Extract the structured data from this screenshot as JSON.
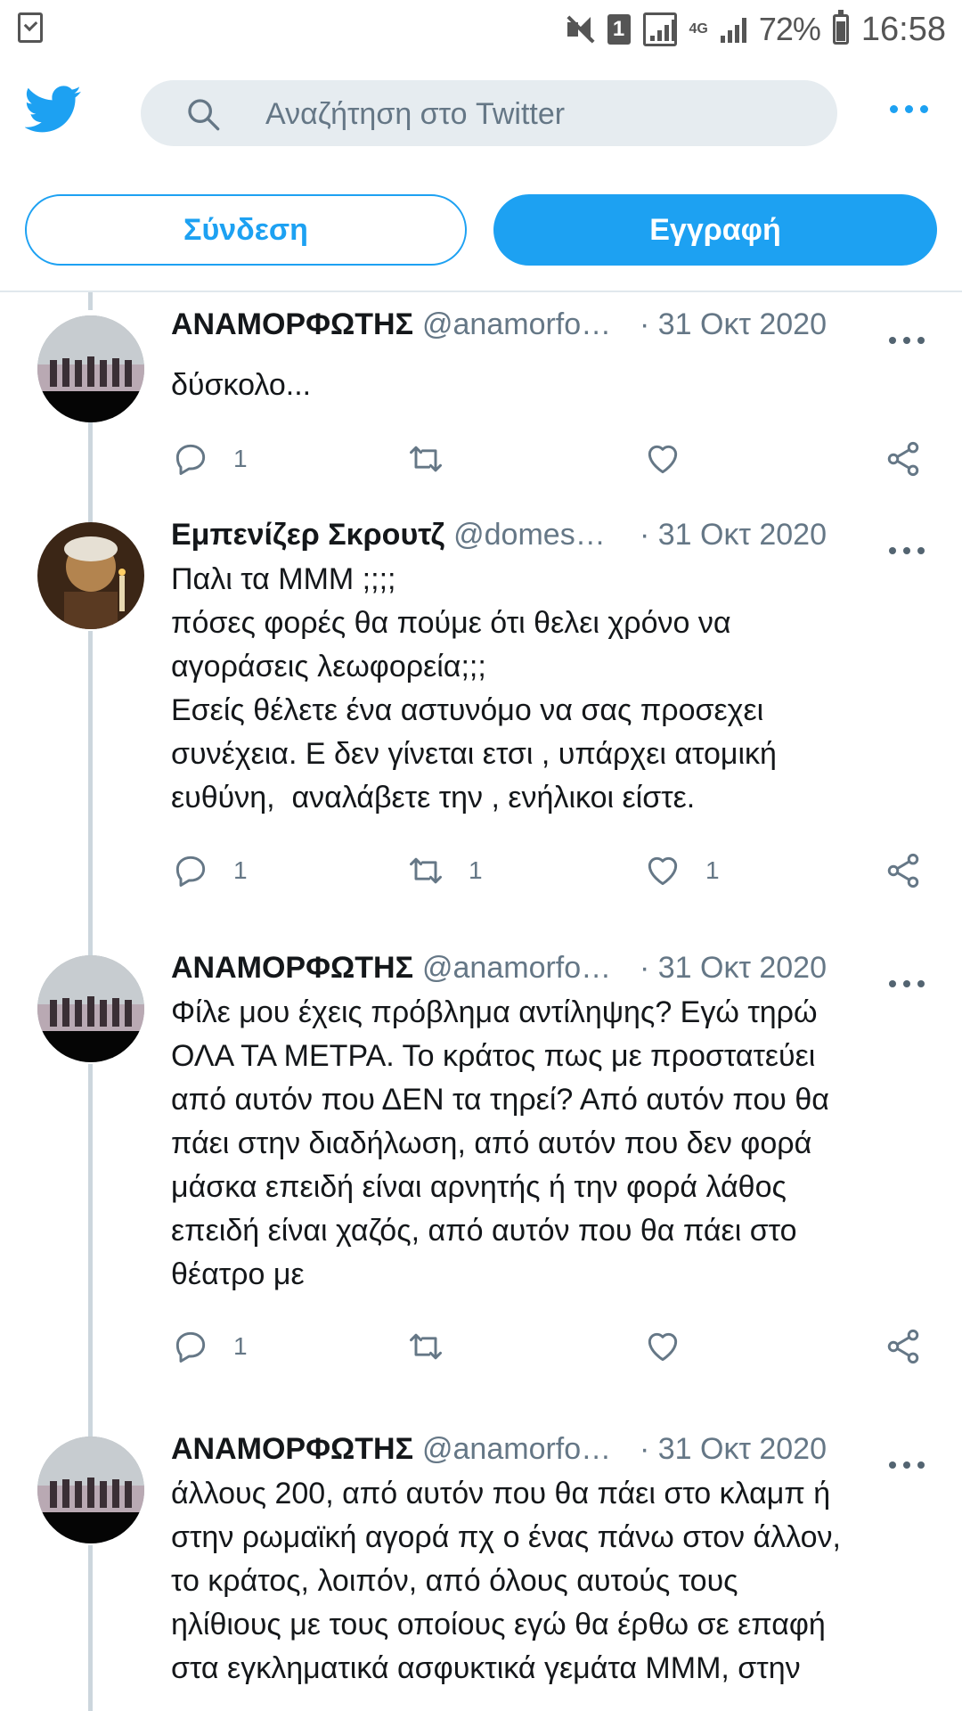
{
  "status_bar": {
    "network": "4G",
    "sim": "1",
    "battery": "72%",
    "time": "16:58"
  },
  "header": {
    "search_placeholder": "Αναζήτηση στο Twitter",
    "menu_icon": "more-horizontal-icon",
    "logo_icon": "twitter-bird-icon"
  },
  "auth": {
    "login_label": "Σύνδεση",
    "signup_label": "Εγγραφή"
  },
  "colors": {
    "accent": "#1da1f2",
    "text": "#14171a",
    "secondary": "#657786",
    "divider": "#e1e8ed"
  },
  "tweets": [
    {
      "name": "ΑΝΑΜΟΡΦΩΤΗΣ",
      "handle": "@anamorfo…",
      "date": "· 31 Οκτ 2020",
      "text": "δύσκολο...",
      "replies": "1",
      "retweets": "",
      "likes": ""
    },
    {
      "name": "Εμπενίζερ Σκρουτζ",
      "handle": "@domes…",
      "date": "· 31 Οκτ 2020",
      "text": "Παλι τα ΜΜΜ ;;;;\nπόσες φορές θα πούμε ότι θελει χρόνο να\nαγοράσεις λεωφορεία;;;\nΕσείς θέλετε ένα αστυνόμο να σας προσεχει\nσυνέχεια. Ε δεν γίνεται ετσι , υπάρχει ατομική\nευθύνη,  αναλάβετε την , ενήλικοι είστε.",
      "replies": "1",
      "retweets": "1",
      "likes": "1"
    },
    {
      "name": "ΑΝΑΜΟΡΦΩΤΗΣ",
      "handle": "@anamorfo…",
      "date": "· 31 Οκτ 2020",
      "text": "Φίλε μου έχεις πρόβλημα αντίληψης? Εγώ τηρώ\nΟΛΑ ΤΑ ΜΕΤΡΑ. Το κράτος πως με προστατεύει\nαπό αυτόν που ΔΕΝ τα τηρεί? Από αυτόν που θα\nπάει στην διαδήλωση, από αυτόν που δεν φορά\nμάσκα επειδή είναι αρνητής ή την φορά λάθος\nεπειδή είναι χαζός, από αυτόν που θα πάει στο\nθέατρο με",
      "replies": "1",
      "retweets": "",
      "likes": ""
    },
    {
      "name": "ΑΝΑΜΟΡΦΩΤΗΣ",
      "handle": "@anamorfo…",
      "date": "· 31 Οκτ 2020",
      "text": "άλλους 200, από αυτόν που θα πάει στο κλαμπ ή\nστην ρωμαϊκή αγορά πχ ο ένας πάνω στον άλλον,\nτο κράτος, λοιπόν, από όλους αυτούς τους\nηλίθιους με τους οποίους εγώ θα έρθω σε επαφή\nστα εγκληματικά ασφυκτικά γεμάτα ΜΜΜ, στην",
      "replies": "",
      "retweets": "",
      "likes": ""
    }
  ]
}
